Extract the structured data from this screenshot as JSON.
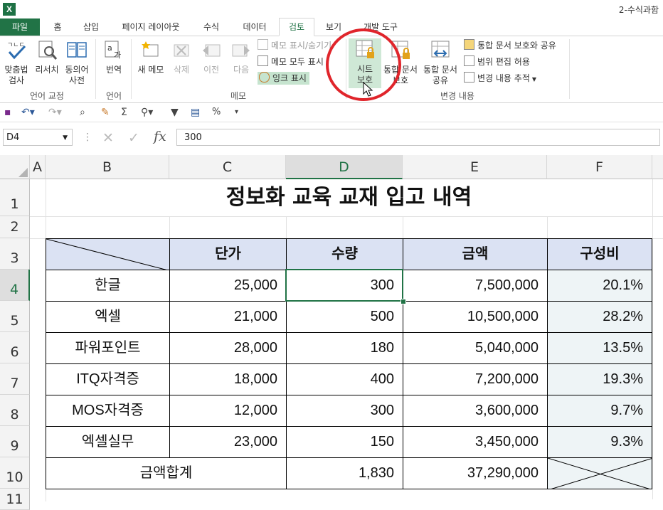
{
  "app": {
    "title": "2-수식과함",
    "icon": "X"
  },
  "tabs": [
    "파일",
    "홈",
    "삽입",
    "페이지 레이아웃",
    "수식",
    "데이터",
    "검토",
    "보기",
    "개발 도구"
  ],
  "ribbon": {
    "proofing": {
      "spell": "맞춤법\n검사",
      "research": "리서치",
      "thesaurus": "동의어\n사전",
      "label": "언어 교정"
    },
    "language": {
      "translate": "번역",
      "label": "언어"
    },
    "comments": {
      "new": "새 메모",
      "delete": "삭제",
      "prev": "이전",
      "next": "다음",
      "show_hide": "메모 표시/숨기기",
      "show_all": "메모 모두 표시",
      "ink": "잉크 표시",
      "label": "메모"
    },
    "changes": {
      "protect_sheet": "시트\n보호",
      "protect_workbook": "통합 문서\n보호",
      "share_workbook": "통합 문서\n공유",
      "protect_share": "통합 문서 보호와 공유",
      "allow_edit": "범위 편집 허용",
      "track": "변경 내용 추적",
      "label": "변경 내용"
    }
  },
  "formula_bar": {
    "name_box": "D4",
    "fx": "fx",
    "value": "300"
  },
  "columns": [
    "A",
    "B",
    "C",
    "D",
    "E",
    "F"
  ],
  "rows": [
    "1",
    "2",
    "3",
    "4",
    "5",
    "6",
    "7",
    "8",
    "9",
    "10",
    "11"
  ],
  "sheet": {
    "title": "정보화 교육 교재 입고 내역",
    "headers": [
      "단가",
      "수량",
      "금액",
      "구성비"
    ],
    "items": [
      {
        "name": "한글",
        "price": "25,000",
        "qty": "300",
        "amount": "7,500,000",
        "ratio": "20.1%"
      },
      {
        "name": "엑셀",
        "price": "21,000",
        "qty": "500",
        "amount": "10,500,000",
        "ratio": "28.2%"
      },
      {
        "name": "파워포인트",
        "price": "28,000",
        "qty": "180",
        "amount": "5,040,000",
        "ratio": "13.5%"
      },
      {
        "name": "ITQ자격증",
        "price": "18,000",
        "qty": "400",
        "amount": "7,200,000",
        "ratio": "19.3%"
      },
      {
        "name": "MOS자격증",
        "price": "12,000",
        "qty": "300",
        "amount": "3,600,000",
        "ratio": "9.7%"
      },
      {
        "name": "엑셀실무",
        "price": "23,000",
        "qty": "150",
        "amount": "3,450,000",
        "ratio": "9.3%"
      }
    ],
    "total": {
      "label": "금액합계",
      "qty": "1,830",
      "amount": "37,290,000"
    }
  },
  "colors": {
    "excel_green": "#217346",
    "header_fill": "#dbe2f3",
    "ratio_fill": "#eef4f6",
    "highlight_circle": "#e0252b"
  }
}
